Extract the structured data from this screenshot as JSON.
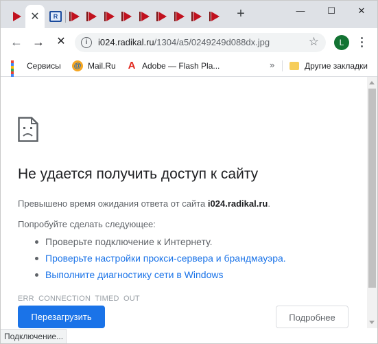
{
  "window_controls": {
    "minimize": "—",
    "maximize": "☐",
    "close": "✕"
  },
  "tabs": {
    "active_close": "✕",
    "radikal_badge": "R",
    "icon_name": "youtube-play-icon",
    "new_tab": "+"
  },
  "toolbar": {
    "back": "←",
    "forward": "→",
    "stop": "✕",
    "url_host": "i024.radikal.ru",
    "url_path": "/1304/a5/0249249d088dx.jpg",
    "bookmark_star": "☆",
    "profile_initial": "L"
  },
  "bookmarks": {
    "items": [
      {
        "label": "Сервисы",
        "icon": "apps-grid-icon"
      },
      {
        "label": "Mail.Ru",
        "icon": "mailru-icon",
        "icon_char": "@"
      },
      {
        "label": "Adobe — Flash Pla...",
        "icon": "adobe-icon",
        "icon_char": "A"
      }
    ],
    "overflow": "»",
    "other_folder": "Другие закладки"
  },
  "error_page": {
    "title": "Не удается получить доступ к сайту",
    "timeout_prefix": "Превышено время ожидания ответа от сайта ",
    "timeout_host": "i024.radikal.ru",
    "timeout_suffix": ".",
    "try_heading": "Попробуйте сделать следующее:",
    "suggestions": [
      "Проверьте подключение к Интернету.",
      "Проверьте настройки прокси-сервера и брандмауэра.",
      "Выполните диагностику сети в Windows"
    ],
    "error_code": "ERR_CONNECTION_TIMED_OUT",
    "reload_button": "Перезагрузить",
    "details_button": "Подробнее"
  },
  "status_bar": {
    "text": "Подключение..."
  },
  "colors": {
    "tabstrip": "#dee1e6",
    "tab_icon_red": "#c1121f",
    "primary_blue": "#1a73e8",
    "link_blue": "#1a73e8",
    "avatar_green": "#137333"
  }
}
